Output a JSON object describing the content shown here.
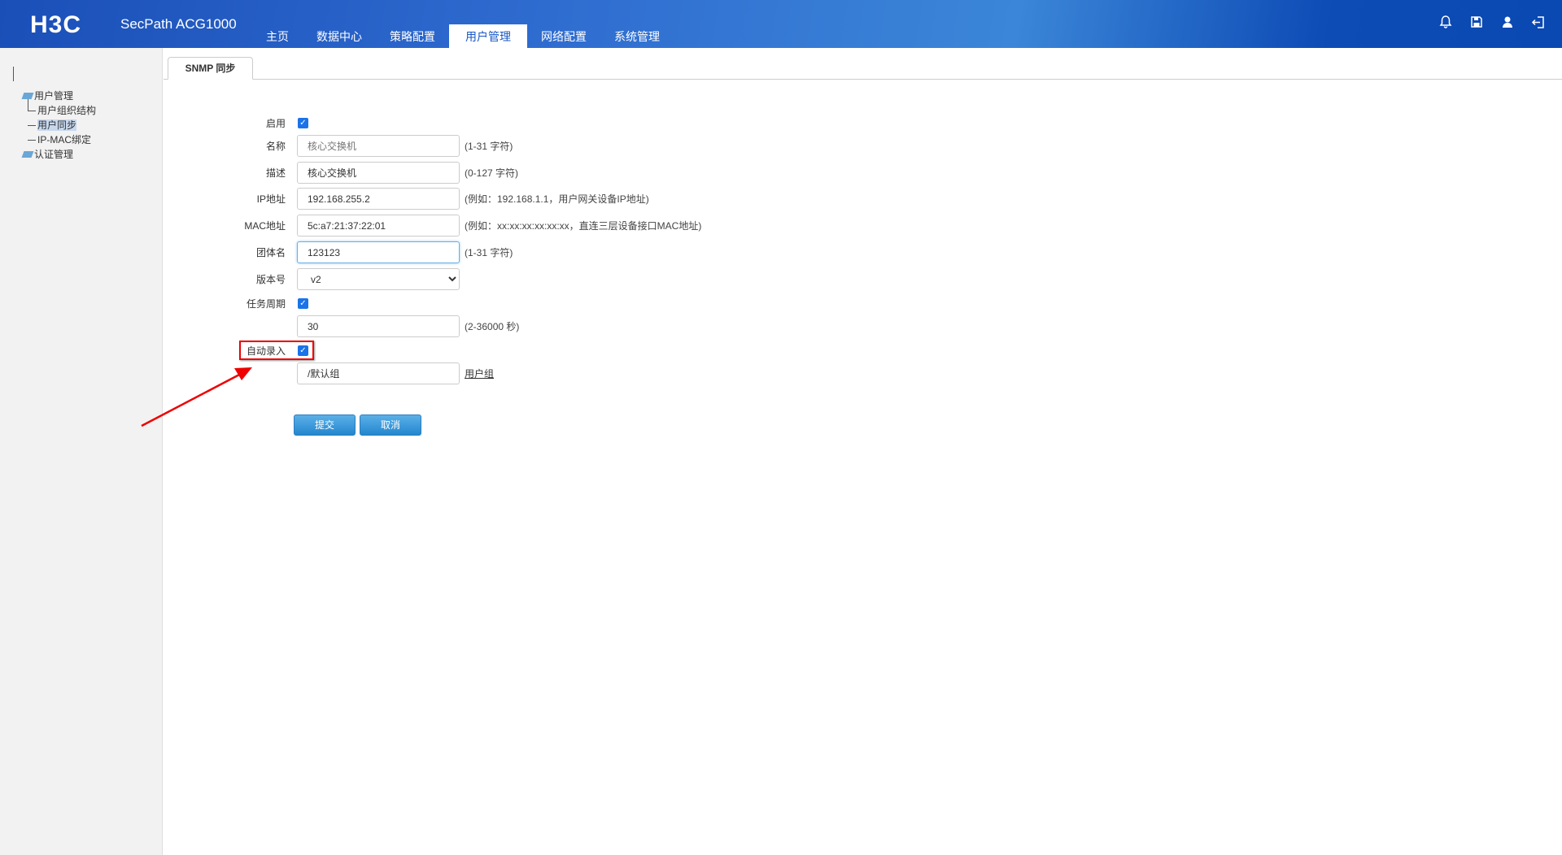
{
  "header": {
    "logo": "H3C",
    "product": "SecPath ACG1000",
    "nav": [
      "主页",
      "数据中心",
      "策略配置",
      "用户管理",
      "网络配置",
      "系统管理"
    ],
    "active_nav": "用户管理",
    "icons": [
      "bell-icon",
      "save-icon",
      "user-icon",
      "logout-icon"
    ]
  },
  "sidebar": {
    "groups": [
      {
        "label": "用户管理",
        "items": [
          "用户组织结构",
          "用户同步",
          "IP-MAC绑定"
        ],
        "selected": "用户同步"
      },
      {
        "label": "认证管理"
      }
    ]
  },
  "tab": "SNMP 同步",
  "form": {
    "enable": {
      "label": "启用",
      "checked": true
    },
    "name": {
      "label": "名称",
      "placeholder": "核心交换机",
      "hint": "(1-31 字符)"
    },
    "desc": {
      "label": "描述",
      "value": "核心交换机",
      "hint": "(0-127 字符)"
    },
    "ip": {
      "label": "IP地址",
      "value": "192.168.255.2",
      "hint": "(例如：192.168.1.1，用户网关设备IP地址)"
    },
    "mac": {
      "label": "MAC地址",
      "value": "5c:a7:21:37:22:01",
      "hint": "(例如：xx:xx:xx:xx:xx:xx，直连三层设备接口MAC地址)"
    },
    "community": {
      "label": "团体名",
      "value": "123123",
      "hint": "(1-31 字符)"
    },
    "version": {
      "label": "版本号",
      "value": "v2"
    },
    "period": {
      "label": "任务周期",
      "checked": true,
      "value": "30",
      "hint": "(2-36000 秒)"
    },
    "auto": {
      "label": "自动录入",
      "checked": true,
      "value": "/默认组",
      "link": "用户组"
    },
    "submit": "提交",
    "cancel": "取消"
  },
  "annotation_color": "#e00000"
}
